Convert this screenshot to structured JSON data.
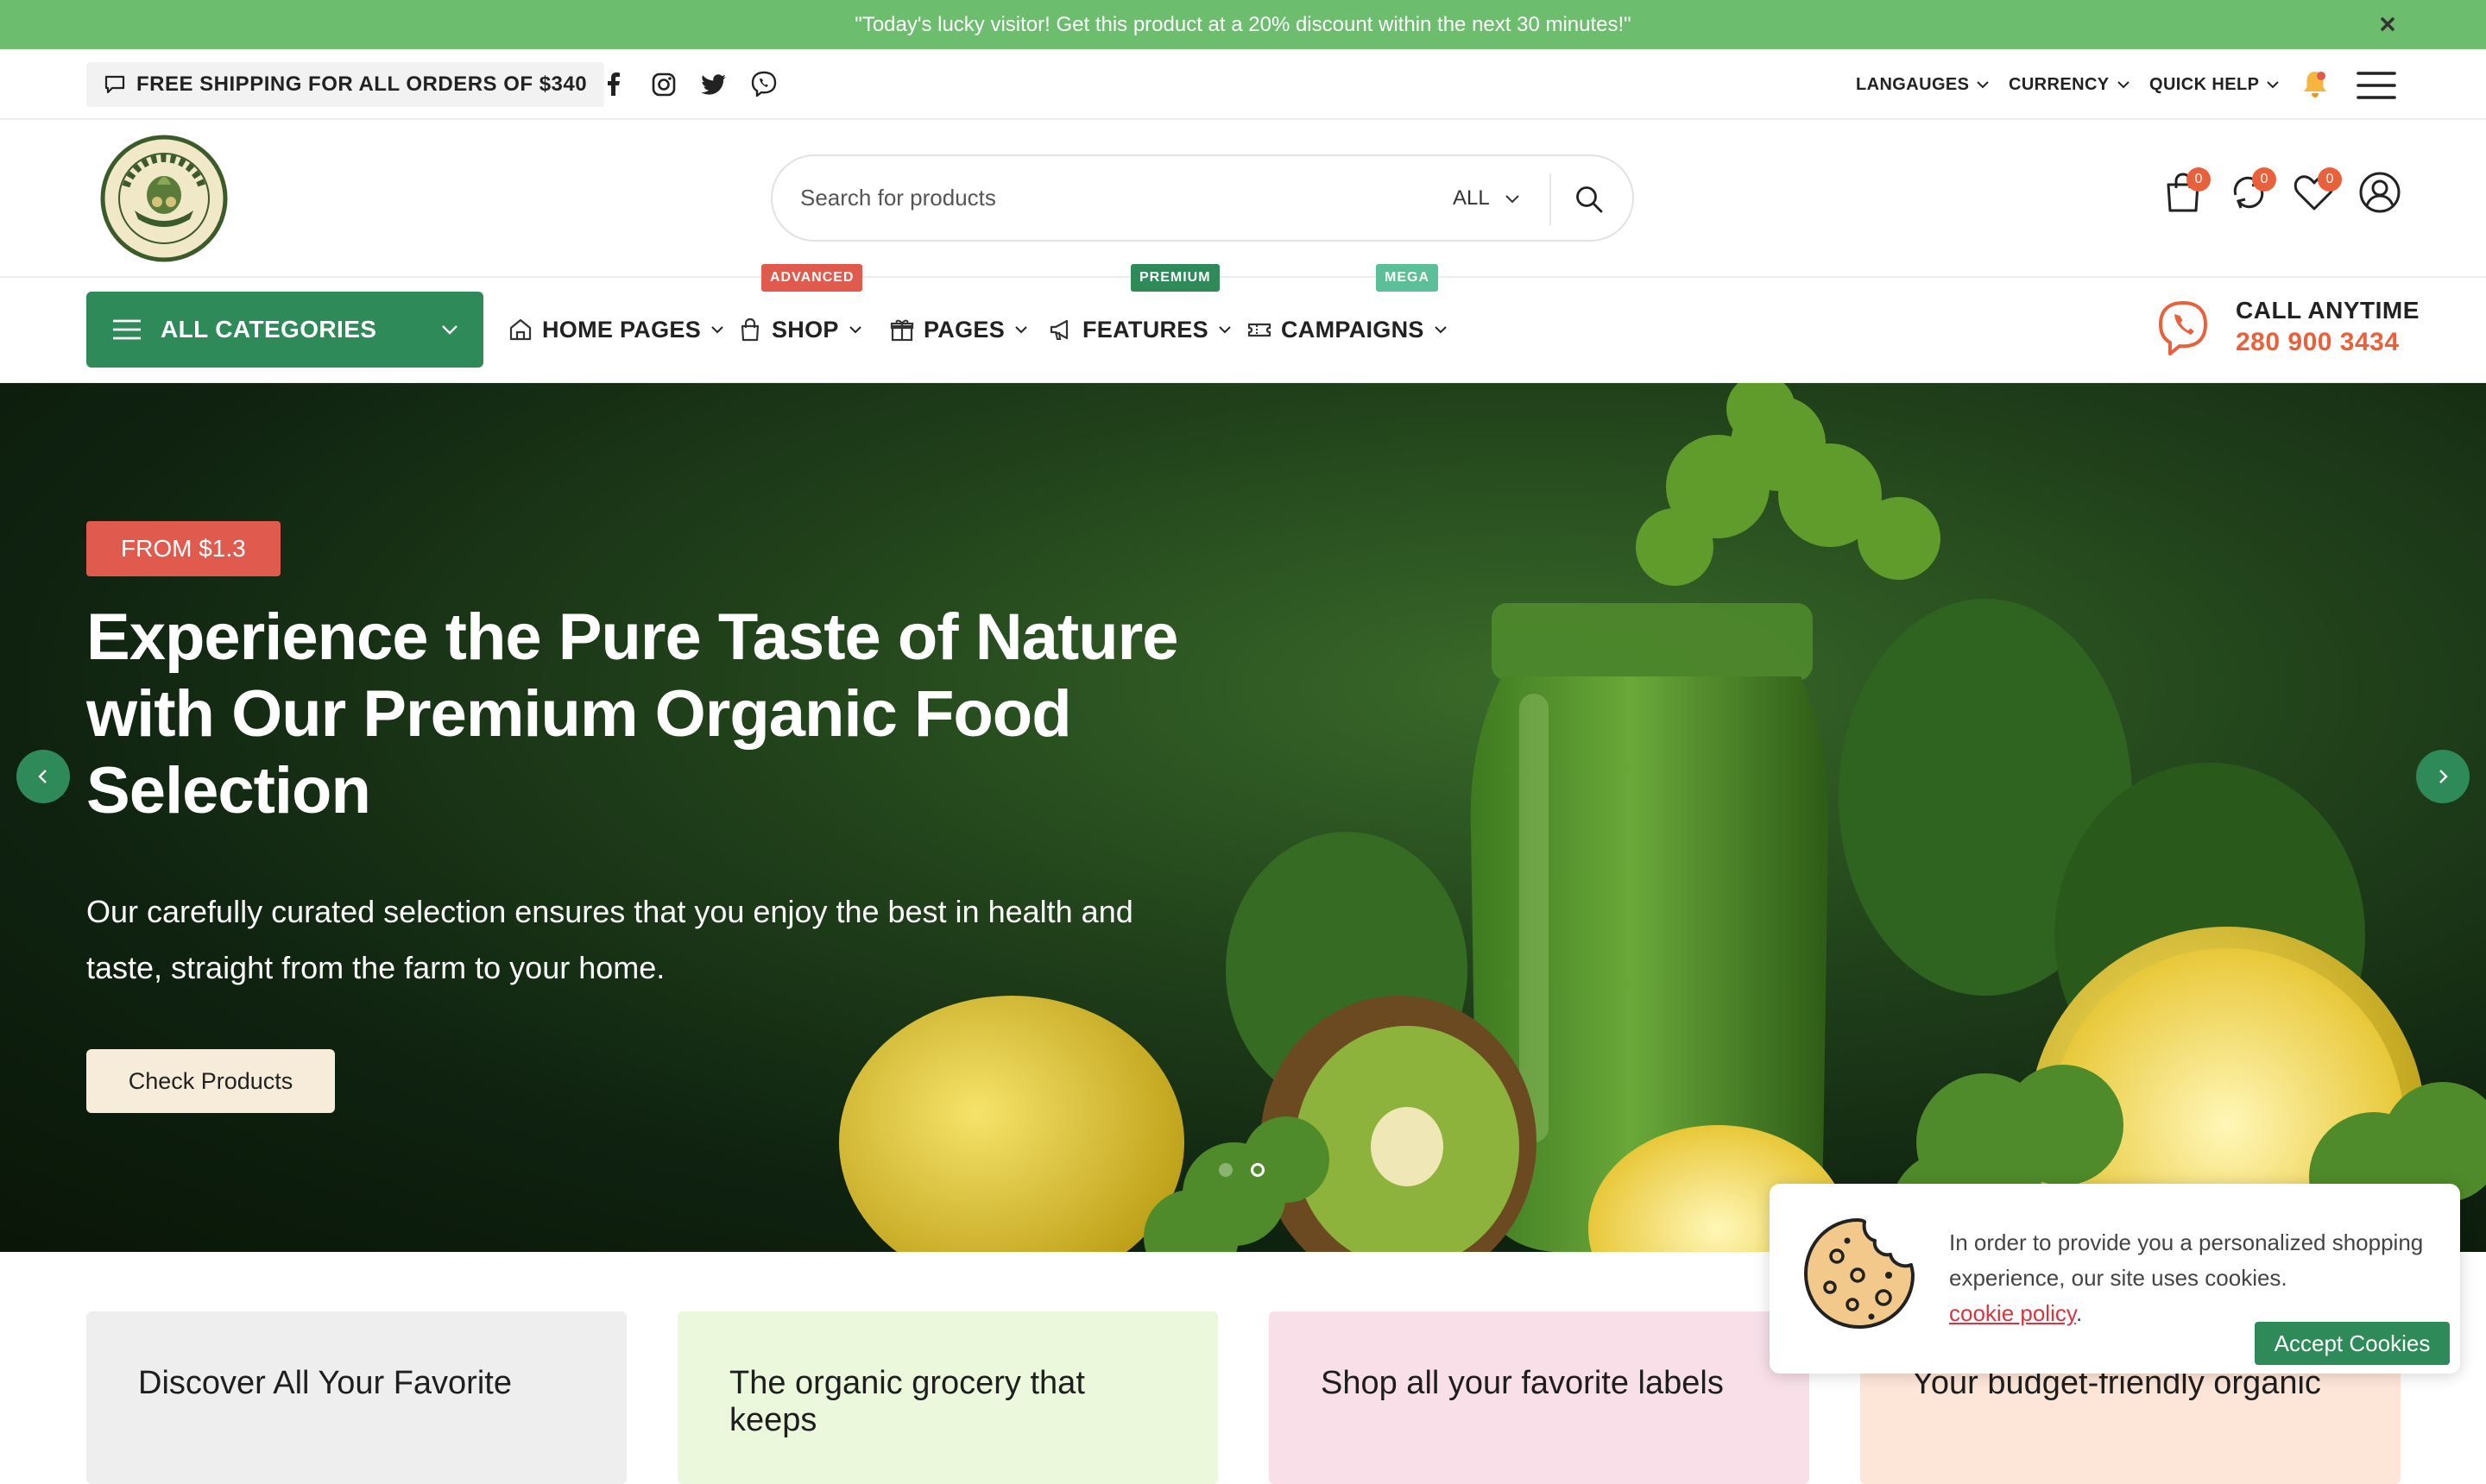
{
  "announcement": {
    "text": "\"Today's lucky visitor! Get this product at a 20% discount within the next 30 minutes!\""
  },
  "topbar": {
    "shipping": "FREE SHIPPING FOR ALL ORDERS OF $340",
    "social": [
      "facebook-icon",
      "instagram-icon",
      "twitter-icon",
      "viber-icon"
    ],
    "languages": "LANGAUGES",
    "currency": "CURRENCY",
    "quick_help": "QUICK HELP"
  },
  "header": {
    "search_placeholder": "Search for products",
    "category": "ALL",
    "cart_count": "0",
    "compare_count": "0",
    "wishlist_count": "0"
  },
  "nav": {
    "all_categories": "ALL CATEGORIES",
    "items": [
      {
        "label": "HOME PAGES",
        "icon": "home-icon"
      },
      {
        "label": "SHOP",
        "icon": "bag-icon",
        "tag": "ADVANCED",
        "tag_color": "#e05a4e"
      },
      {
        "label": "PAGES",
        "icon": "gift-icon"
      },
      {
        "label": "FEATURES",
        "icon": "megaphone-icon",
        "tag": "PREMIUM",
        "tag_color": "#2e8a58"
      },
      {
        "label": "CAMPAIGNS",
        "icon": "ticket-icon",
        "tag": "MEGA",
        "tag_color": "#5bbf9a"
      }
    ],
    "call_label": "CALL ANYTIME",
    "call_number": "280 900 3434"
  },
  "hero": {
    "price_tag": "FROM $1.3",
    "title": "Experience the Pure Taste of Nature with Our Premium Organic Food Selection",
    "subtitle": "Our carefully curated selection ensures that you enjoy the best in health and taste, straight from the farm to your home.",
    "button": "Check Products",
    "slides": 2,
    "active_slide": 2
  },
  "cards": [
    {
      "title": "Discover All Your Favorite",
      "bg": "#eeeeee"
    },
    {
      "title": "The organic grocery that keeps",
      "bg": "#ebf8dc"
    },
    {
      "title": "Shop all your favorite labels",
      "bg": "#f8dfe8"
    },
    {
      "title": "Your budget-friendly organic",
      "bg": "#fde6d8"
    }
  ],
  "cookie": {
    "text": "In order to provide you a personalized shopping experience, our site uses cookies.",
    "link": "cookie policy",
    "button": "Accept Cookies"
  },
  "colors": {
    "brand_green": "#2e8a58",
    "announce_green": "#6dbd6e",
    "accent_orange": "#e8613c",
    "tag_red": "#e05a4e"
  }
}
